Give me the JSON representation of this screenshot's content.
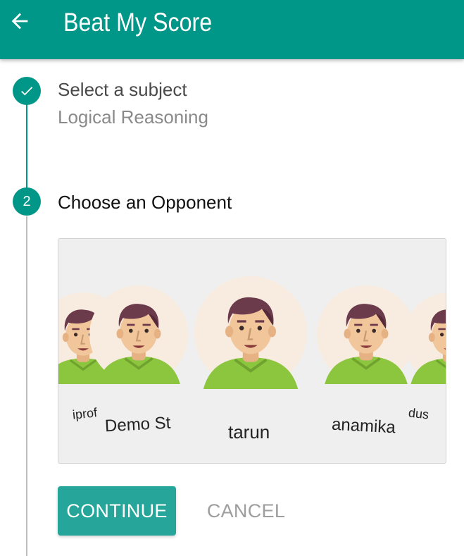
{
  "appbar": {
    "title": "Beat My Score",
    "back_icon": "arrow-back-icon",
    "color": "#009688"
  },
  "step1": {
    "title": "Select a subject",
    "value": "Logical Reasoning",
    "icon": "check-icon",
    "status": "completed"
  },
  "step2": {
    "number": "2",
    "title": "Choose an Opponent",
    "status": "active"
  },
  "opponents": [
    {
      "name": "iprof"
    },
    {
      "name": "Demo St"
    },
    {
      "name": "tarun",
      "selected": true
    },
    {
      "name": "anamika"
    },
    {
      "name": "dus"
    }
  ],
  "actions": {
    "continue_label": "CONTINUE",
    "cancel_label": "CANCEL"
  },
  "colors": {
    "primary": "#009688",
    "button": "#26a69a",
    "shirt": "#8cc63f",
    "hair": "#6b3a4b",
    "skin": "#f0c69a",
    "avatar_bg": "#f7ecdf"
  }
}
